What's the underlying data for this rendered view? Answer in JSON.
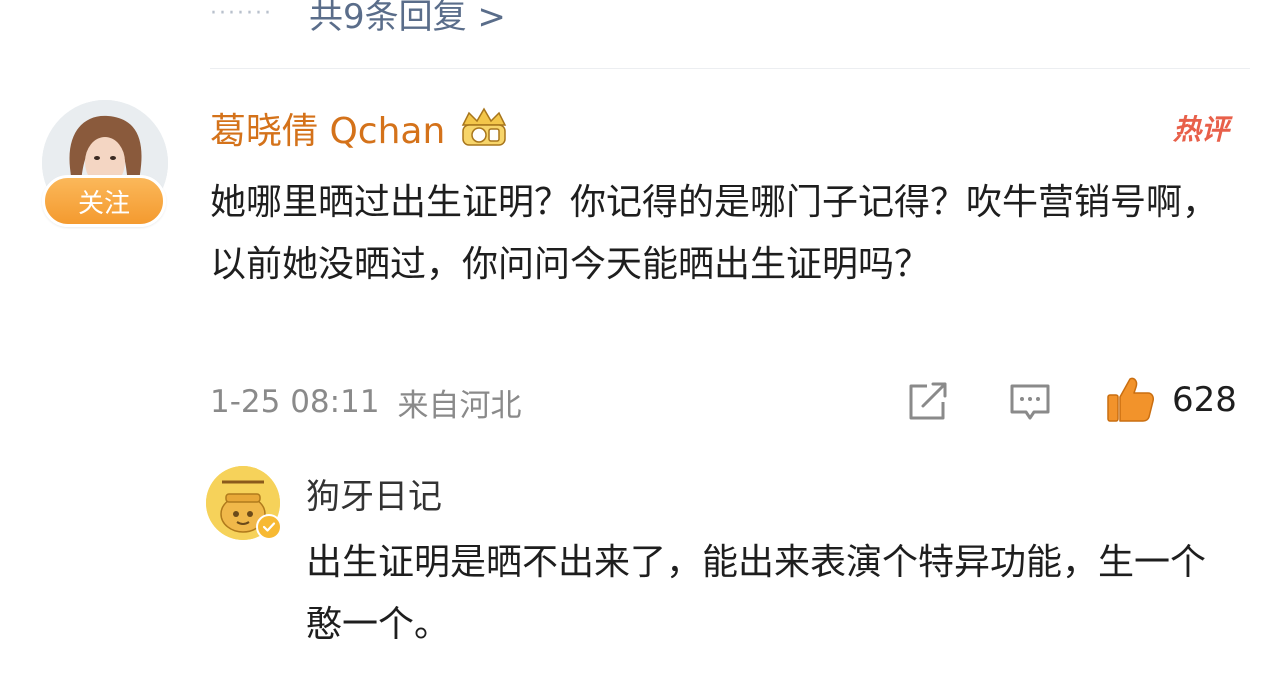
{
  "replies_link": {
    "dots": "·······",
    "label": "共9条回复 >"
  },
  "comment": {
    "follow_label": "关注",
    "username": "葛晓倩 Qchan",
    "user_badge_icon": "crown-vip-icon",
    "hot_label": "热评",
    "text": "她哪里晒过出生证明？你记得的是哪门子记得？吹牛营销号啊，以前她没晒过，你问问今天能晒出生证明吗？",
    "time": "1-25 08:11",
    "location": "来自河北",
    "share_icon": "share-icon",
    "reply_icon": "comment-icon",
    "like_icon": "thumbs-up-icon",
    "like_count": "628",
    "accent_color": "#d4721a",
    "like_color": "#f2932b"
  },
  "sub_reply": {
    "username": "狗牙日记",
    "verify_icon": "verified-icon",
    "text": "出生证明是晒不出来了，能出来表演个特异功能，生一个憨一个。"
  }
}
